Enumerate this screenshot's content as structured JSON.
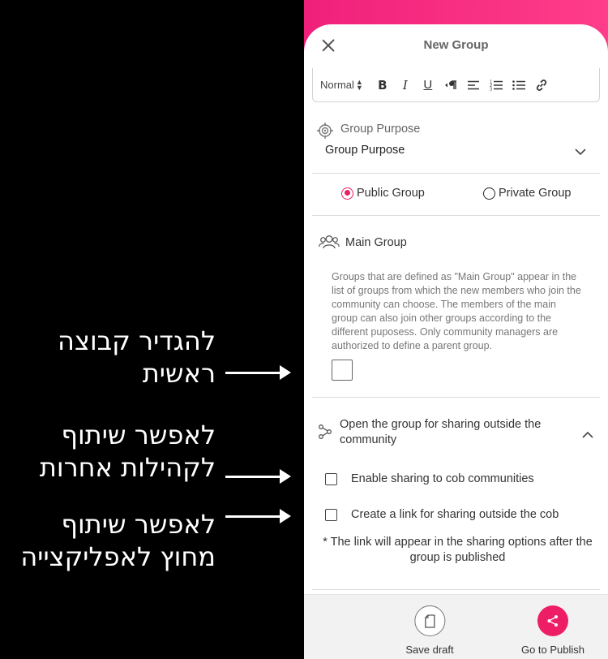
{
  "annotations": [
    {
      "line1": "להגדיר קבוצה",
      "line2": "ראשית"
    },
    {
      "line1": "לאפשר שיתוף",
      "line2": "לקהילות אחרות"
    },
    {
      "line1": "לאפשר שיתוף",
      "line2": "מחוץ לאפליקצייה"
    }
  ],
  "header": {
    "title": "New Group"
  },
  "toolbar": {
    "format_value": "Normal"
  },
  "purpose": {
    "label": "Group Purpose",
    "value": "Group Purpose"
  },
  "privacy": {
    "public_label": "Public Group",
    "private_label": "Private Group",
    "selected": "public"
  },
  "main_group": {
    "title": "Main Group",
    "description": "Groups that are defined as \"Main Group\" appear in the list of groups from which the new members who join the community can choose. The members of the main group can also join other groups according to the different puposess. Only community managers are authorized to define a parent group."
  },
  "sharing": {
    "title": "Open the group for sharing outside the community",
    "option1": "Enable sharing to cob communities",
    "option2": "Create a link for sharing outside the cob",
    "note": "* The link will appear in the sharing options after the group is published"
  },
  "bottom": {
    "save_label": "Save draft",
    "publish_label": "Go to Publish"
  },
  "colors": {
    "accent": "#ee1e66",
    "header_gradient_start": "#f0207a"
  }
}
